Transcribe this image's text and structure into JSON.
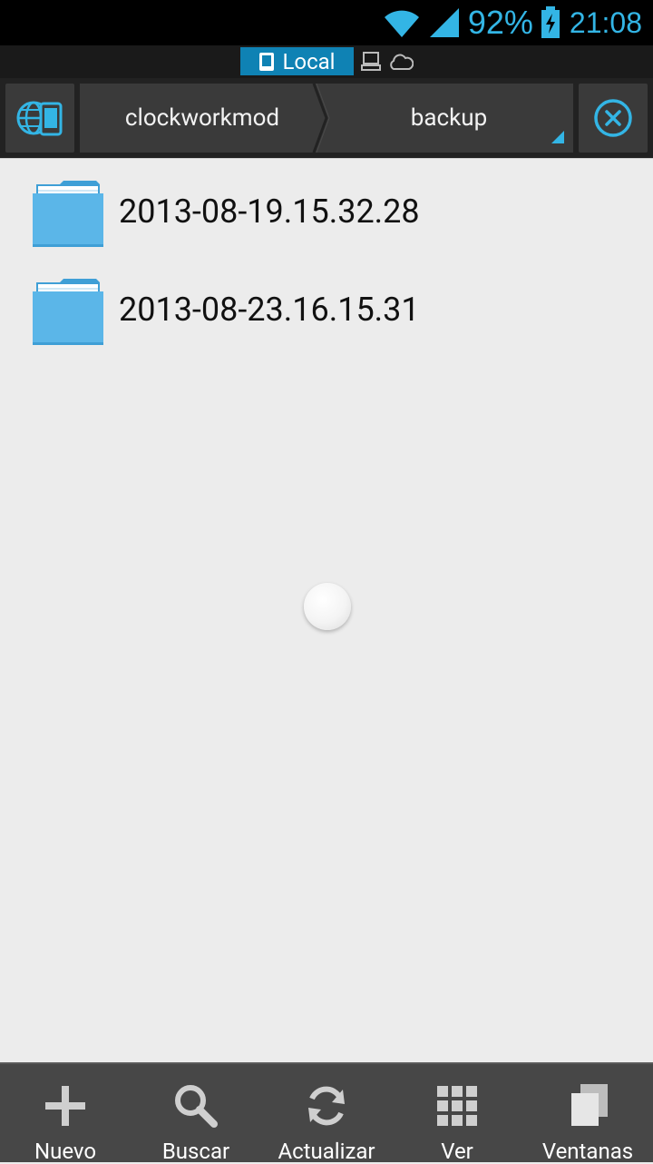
{
  "status_bar": {
    "battery_percent": "92%",
    "time": "21:08",
    "icons": [
      "wifi-icon",
      "signal-icon",
      "battery-charging-icon"
    ]
  },
  "location_tabs": {
    "active": "Local",
    "icons": [
      "phone-icon",
      "network-icon",
      "cloud-icon"
    ]
  },
  "breadcrumb": {
    "items": [
      "clockworkmod",
      "backup"
    ]
  },
  "files": [
    {
      "name": "2013-08-19.15.32.28",
      "type": "folder"
    },
    {
      "name": "2013-08-23.16.15.31",
      "type": "folder"
    }
  ],
  "bottom_bar": {
    "items": [
      {
        "label": "Nuevo",
        "icon": "plus-icon"
      },
      {
        "label": "Buscar",
        "icon": "search-icon"
      },
      {
        "label": "Actualizar",
        "icon": "refresh-icon"
      },
      {
        "label": "Ver",
        "icon": "grid-icon"
      },
      {
        "label": "Ventanas",
        "icon": "windows-icon"
      }
    ]
  },
  "colors": {
    "accent": "#33b5e5",
    "tab_active": "#0f82b4",
    "folder": "#5bb6e8"
  }
}
